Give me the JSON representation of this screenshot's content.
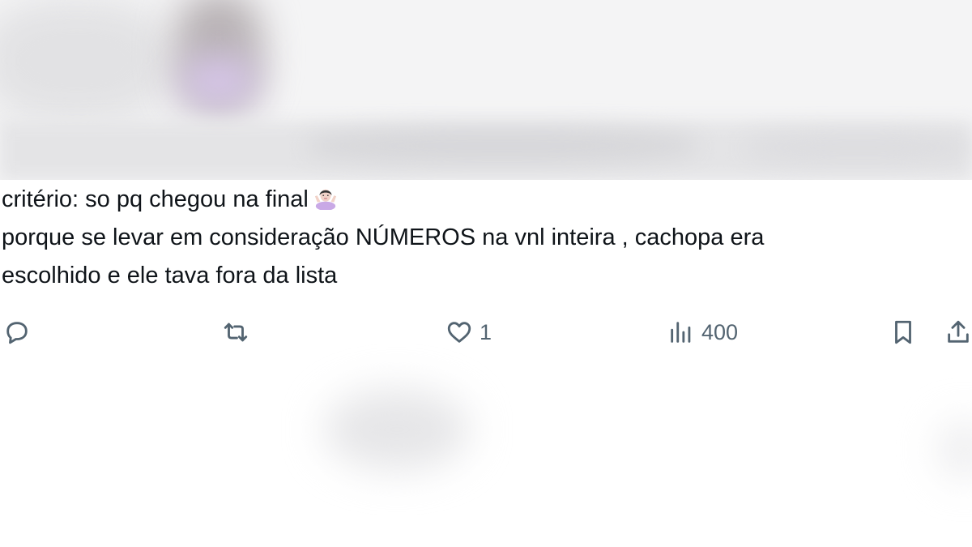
{
  "tweet": {
    "lines": [
      "critério: so pq chegou na final",
      "porque se levar em consideração NÚMEROS na vnl inteira , cachopa era",
      "escolhido e ele tava fora da lista"
    ],
    "emoji": "person-shrugging-emoji"
  },
  "actions": {
    "reply": {
      "icon": "reply-icon",
      "count": ""
    },
    "retweet": {
      "icon": "retweet-icon",
      "count": ""
    },
    "like": {
      "icon": "heart-icon",
      "count": "1"
    },
    "views": {
      "icon": "views-icon",
      "count": "400"
    },
    "bookmark": {
      "icon": "bookmark-icon"
    },
    "share": {
      "icon": "share-icon"
    }
  },
  "colors": {
    "text": "#0f1419",
    "icon": "#536471"
  }
}
